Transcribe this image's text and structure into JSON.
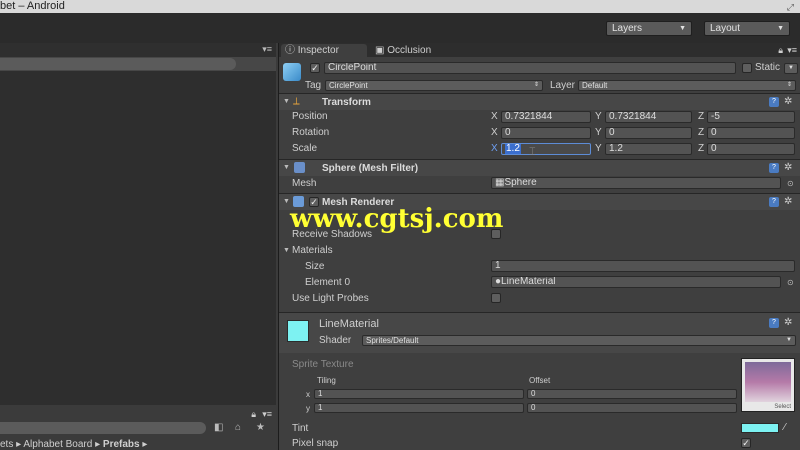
{
  "window": {
    "title": "bet – Android"
  },
  "toolbar": {
    "layers_label": "Layers",
    "layout_label": "Layout"
  },
  "left_panel": {
    "breadcrumb": {
      "item1": "ets ▸",
      "item2": "Alphabet Board ▸",
      "item3": "Prefabs",
      "item4": "▸"
    }
  },
  "inspector": {
    "tabs": [
      {
        "label": "Inspector"
      },
      {
        "label": "Occlusion"
      }
    ],
    "object": {
      "name": "CirclePoint",
      "static_label": "Static",
      "tag_label": "Tag",
      "tag_value": "CirclePoint",
      "layer_label": "Layer",
      "layer_value": "Default"
    },
    "transform": {
      "title": "Transform",
      "rows": [
        {
          "label": "Position",
          "x": "0.7321844",
          "y": "0.7321844",
          "z": "-5"
        },
        {
          "label": "Rotation",
          "x": "0",
          "y": "0",
          "z": "0"
        },
        {
          "label": "Scale",
          "x": "1.2",
          "y": "1.2",
          "z": "0"
        }
      ],
      "axis": {
        "x": "X",
        "y": "Y",
        "z": "Z"
      }
    },
    "mesh_filter": {
      "title": "Sphere (Mesh Filter)",
      "mesh_label": "Mesh",
      "mesh_value": "Sphere"
    },
    "mesh_renderer": {
      "title": "Mesh Renderer",
      "receive_shadows_label": "Receive Shadows",
      "materials_label": "Materials",
      "size_label": "Size",
      "size_value": "1",
      "element0_label": "Element 0",
      "element0_value": "LineMaterial",
      "light_probes_label": "Use Light Probes"
    },
    "material": {
      "name": "LineMaterial",
      "shader_label": "Shader",
      "shader_value": "Sprites/Default",
      "sprite_texture_label": "Sprite Texture",
      "tiling_label": "Tiling",
      "offset_label": "Offset",
      "x_label": "x",
      "y_label": "y",
      "tiling_x": "1",
      "tiling_y": "1",
      "offset_x": "0",
      "offset_y": "0",
      "select_label": "Select",
      "tint_label": "Tint",
      "pixel_snap_label": "Pixel snap",
      "tint_color": "#7df2f2"
    }
  },
  "watermark": {
    "text": "www.cgtsj.com"
  }
}
